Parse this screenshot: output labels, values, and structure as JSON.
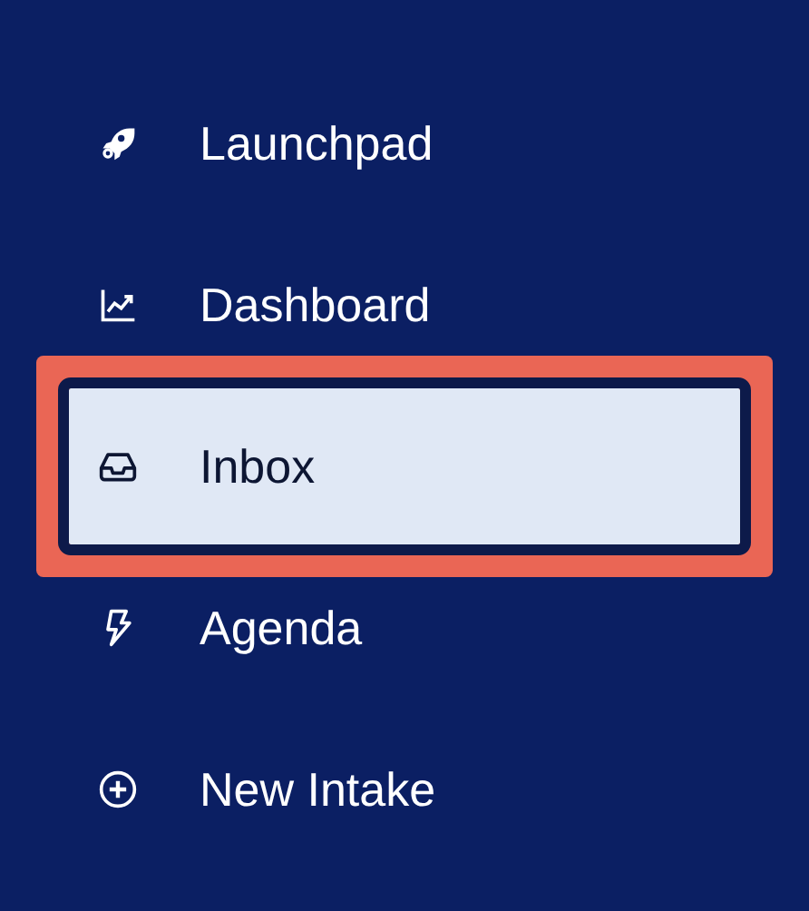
{
  "nav": {
    "items": [
      {
        "label": "Launchpad",
        "selected": false
      },
      {
        "label": "Dashboard",
        "selected": false
      },
      {
        "label": "Inbox",
        "selected": true
      },
      {
        "label": "Agenda",
        "selected": false
      },
      {
        "label": "New Intake",
        "selected": false
      }
    ]
  }
}
